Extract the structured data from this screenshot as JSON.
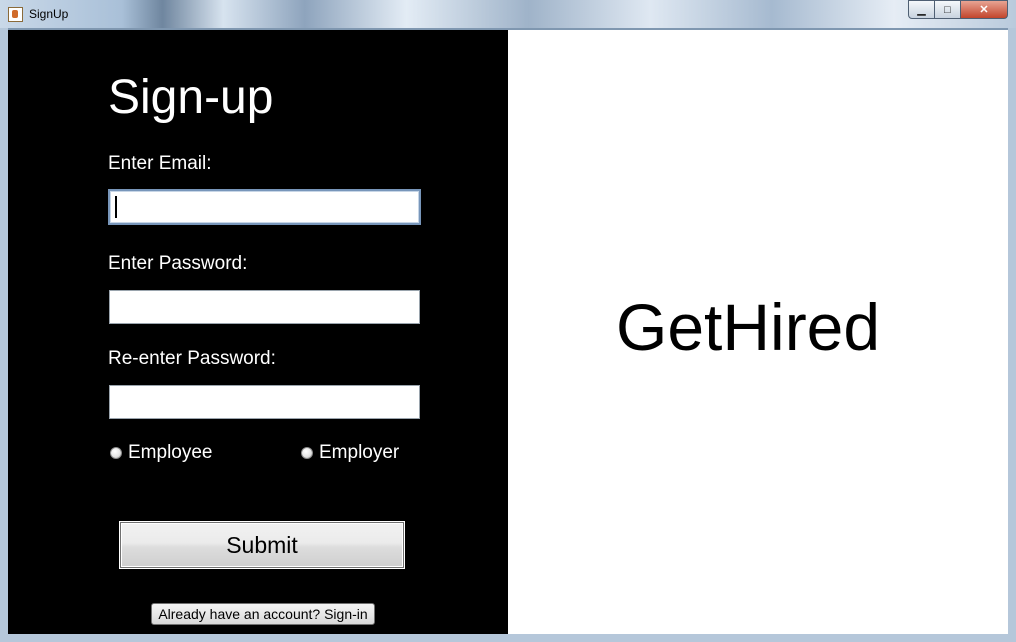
{
  "window": {
    "title": "SignUp",
    "min_glyph": "▁",
    "max_glyph": "□",
    "close_glyph": "✕"
  },
  "form": {
    "heading": "Sign-up",
    "email_label": "Enter Email:",
    "email_value": "",
    "password_label": "Enter Password:",
    "password_value": "",
    "reenter_label": "Re-enter Password:",
    "reenter_value": "",
    "radio_employee": "Employee",
    "radio_employer": "Employer",
    "submit_label": "Submit",
    "signin_label": "Already have an account? Sign-in"
  },
  "brand": {
    "name": "GetHired"
  },
  "icons": {
    "app": "java-cup-icon"
  }
}
